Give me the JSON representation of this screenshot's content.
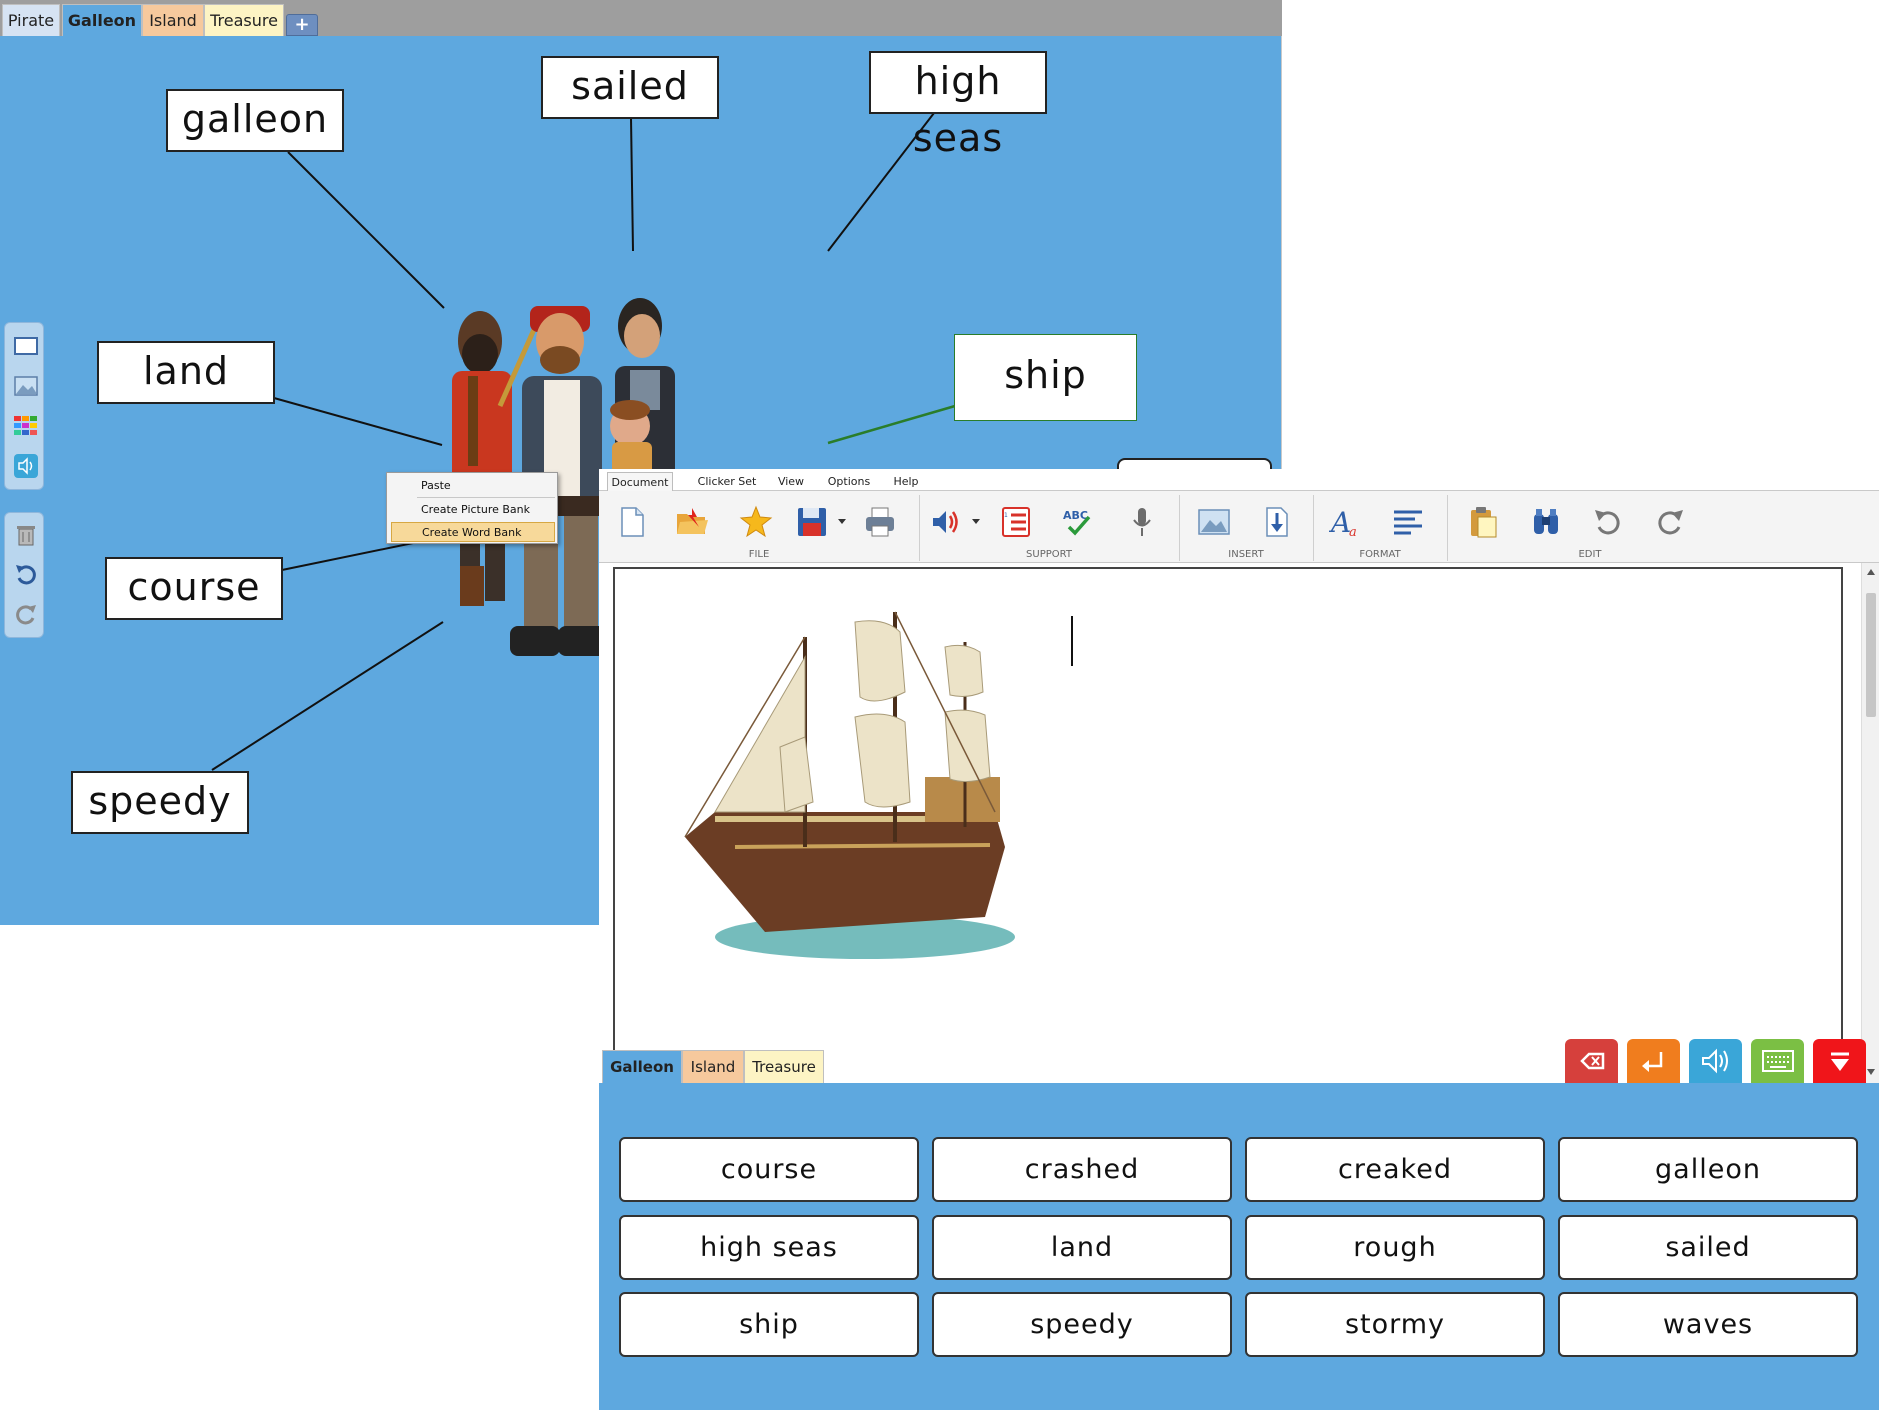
{
  "mindmap": {
    "tabs": [
      {
        "label": "Pirate",
        "color": "#d6e3f3"
      },
      {
        "label": "Galleon",
        "color": "#5ea8df"
      },
      {
        "label": "Island",
        "color": "#f6c99d"
      },
      {
        "label": "Treasure",
        "color": "#fdf4c4"
      }
    ],
    "add_tab_label": "+",
    "words": [
      "galleon",
      "sailed",
      "high seas",
      "land",
      "ship",
      "course",
      "speedy"
    ]
  },
  "context_menu": {
    "items": [
      "Paste",
      "Create Picture Bank",
      "Create Word Bank"
    ],
    "highlighted": "Create Word Bank"
  },
  "document": {
    "ribbon_tabs": [
      "Document",
      "Clicker Set",
      "View",
      "Options",
      "Help"
    ],
    "ribbon_groups": [
      "FILE",
      "SUPPORT",
      "INSERT",
      "FORMAT",
      "EDIT"
    ],
    "icons": {
      "file": [
        "new-document-icon",
        "open-folder-icon",
        "favourite-star-icon",
        "save-disk-icon",
        "print-icon"
      ],
      "support": [
        "speech-volume-icon",
        "numbered-list-icon",
        "spell-check-icon",
        "microphone-icon"
      ],
      "insert": [
        "insert-picture-icon",
        "insert-file-icon"
      ],
      "format": [
        "font-style-icon",
        "paragraph-align-icon"
      ],
      "edit": [
        "clipboard-icon",
        "find-binoculars-icon",
        "undo-icon",
        "redo-icon"
      ]
    }
  },
  "word_bank": {
    "tabs": [
      {
        "label": "Galleon",
        "color": "#5ea8df"
      },
      {
        "label": "Island",
        "color": "#f6c99d"
      },
      {
        "label": "Treasure",
        "color": "#fdf4c4"
      }
    ],
    "action_buttons": [
      {
        "name": "backspace-button",
        "icon": "backspace-icon",
        "color": "#d6403c"
      },
      {
        "name": "enter-button",
        "icon": "enter-arrow-icon",
        "color": "#f07d1e"
      },
      {
        "name": "speak-button",
        "icon": "speaker-icon",
        "color": "#3aa6d8"
      },
      {
        "name": "keyboard-button",
        "icon": "keyboard-icon",
        "color": "#7bbf44"
      },
      {
        "name": "collapse-button",
        "icon": "down-arrow-icon",
        "color": "#f0151a"
      }
    ],
    "words": [
      "course",
      "crashed",
      "creaked",
      "galleon",
      "high seas",
      "land",
      "rough",
      "sailed",
      "ship",
      "speedy",
      "stormy",
      "waves"
    ]
  }
}
